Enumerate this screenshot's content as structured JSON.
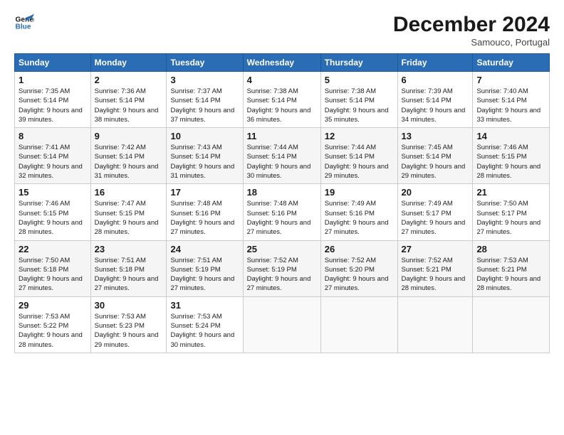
{
  "logo": {
    "line1": "General",
    "line2": "Blue"
  },
  "header": {
    "title": "December 2024",
    "subtitle": "Samouco, Portugal"
  },
  "days_of_week": [
    "Sunday",
    "Monday",
    "Tuesday",
    "Wednesday",
    "Thursday",
    "Friday",
    "Saturday"
  ],
  "weeks": [
    [
      {
        "day": "1",
        "sunrise": "Sunrise: 7:35 AM",
        "sunset": "Sunset: 5:14 PM",
        "daylight": "Daylight: 9 hours and 39 minutes."
      },
      {
        "day": "2",
        "sunrise": "Sunrise: 7:36 AM",
        "sunset": "Sunset: 5:14 PM",
        "daylight": "Daylight: 9 hours and 38 minutes."
      },
      {
        "day": "3",
        "sunrise": "Sunrise: 7:37 AM",
        "sunset": "Sunset: 5:14 PM",
        "daylight": "Daylight: 9 hours and 37 minutes."
      },
      {
        "day": "4",
        "sunrise": "Sunrise: 7:38 AM",
        "sunset": "Sunset: 5:14 PM",
        "daylight": "Daylight: 9 hours and 36 minutes."
      },
      {
        "day": "5",
        "sunrise": "Sunrise: 7:38 AM",
        "sunset": "Sunset: 5:14 PM",
        "daylight": "Daylight: 9 hours and 35 minutes."
      },
      {
        "day": "6",
        "sunrise": "Sunrise: 7:39 AM",
        "sunset": "Sunset: 5:14 PM",
        "daylight": "Daylight: 9 hours and 34 minutes."
      },
      {
        "day": "7",
        "sunrise": "Sunrise: 7:40 AM",
        "sunset": "Sunset: 5:14 PM",
        "daylight": "Daylight: 9 hours and 33 minutes."
      }
    ],
    [
      {
        "day": "8",
        "sunrise": "Sunrise: 7:41 AM",
        "sunset": "Sunset: 5:14 PM",
        "daylight": "Daylight: 9 hours and 32 minutes."
      },
      {
        "day": "9",
        "sunrise": "Sunrise: 7:42 AM",
        "sunset": "Sunset: 5:14 PM",
        "daylight": "Daylight: 9 hours and 31 minutes."
      },
      {
        "day": "10",
        "sunrise": "Sunrise: 7:43 AM",
        "sunset": "Sunset: 5:14 PM",
        "daylight": "Daylight: 9 hours and 31 minutes."
      },
      {
        "day": "11",
        "sunrise": "Sunrise: 7:44 AM",
        "sunset": "Sunset: 5:14 PM",
        "daylight": "Daylight: 9 hours and 30 minutes."
      },
      {
        "day": "12",
        "sunrise": "Sunrise: 7:44 AM",
        "sunset": "Sunset: 5:14 PM",
        "daylight": "Daylight: 9 hours and 29 minutes."
      },
      {
        "day": "13",
        "sunrise": "Sunrise: 7:45 AM",
        "sunset": "Sunset: 5:14 PM",
        "daylight": "Daylight: 9 hours and 29 minutes."
      },
      {
        "day": "14",
        "sunrise": "Sunrise: 7:46 AM",
        "sunset": "Sunset: 5:15 PM",
        "daylight": "Daylight: 9 hours and 28 minutes."
      }
    ],
    [
      {
        "day": "15",
        "sunrise": "Sunrise: 7:46 AM",
        "sunset": "Sunset: 5:15 PM",
        "daylight": "Daylight: 9 hours and 28 minutes."
      },
      {
        "day": "16",
        "sunrise": "Sunrise: 7:47 AM",
        "sunset": "Sunset: 5:15 PM",
        "daylight": "Daylight: 9 hours and 28 minutes."
      },
      {
        "day": "17",
        "sunrise": "Sunrise: 7:48 AM",
        "sunset": "Sunset: 5:16 PM",
        "daylight": "Daylight: 9 hours and 27 minutes."
      },
      {
        "day": "18",
        "sunrise": "Sunrise: 7:48 AM",
        "sunset": "Sunset: 5:16 PM",
        "daylight": "Daylight: 9 hours and 27 minutes."
      },
      {
        "day": "19",
        "sunrise": "Sunrise: 7:49 AM",
        "sunset": "Sunset: 5:16 PM",
        "daylight": "Daylight: 9 hours and 27 minutes."
      },
      {
        "day": "20",
        "sunrise": "Sunrise: 7:49 AM",
        "sunset": "Sunset: 5:17 PM",
        "daylight": "Daylight: 9 hours and 27 minutes."
      },
      {
        "day": "21",
        "sunrise": "Sunrise: 7:50 AM",
        "sunset": "Sunset: 5:17 PM",
        "daylight": "Daylight: 9 hours and 27 minutes."
      }
    ],
    [
      {
        "day": "22",
        "sunrise": "Sunrise: 7:50 AM",
        "sunset": "Sunset: 5:18 PM",
        "daylight": "Daylight: 9 hours and 27 minutes."
      },
      {
        "day": "23",
        "sunrise": "Sunrise: 7:51 AM",
        "sunset": "Sunset: 5:18 PM",
        "daylight": "Daylight: 9 hours and 27 minutes."
      },
      {
        "day": "24",
        "sunrise": "Sunrise: 7:51 AM",
        "sunset": "Sunset: 5:19 PM",
        "daylight": "Daylight: 9 hours and 27 minutes."
      },
      {
        "day": "25",
        "sunrise": "Sunrise: 7:52 AM",
        "sunset": "Sunset: 5:19 PM",
        "daylight": "Daylight: 9 hours and 27 minutes."
      },
      {
        "day": "26",
        "sunrise": "Sunrise: 7:52 AM",
        "sunset": "Sunset: 5:20 PM",
        "daylight": "Daylight: 9 hours and 27 minutes."
      },
      {
        "day": "27",
        "sunrise": "Sunrise: 7:52 AM",
        "sunset": "Sunset: 5:21 PM",
        "daylight": "Daylight: 9 hours and 28 minutes."
      },
      {
        "day": "28",
        "sunrise": "Sunrise: 7:53 AM",
        "sunset": "Sunset: 5:21 PM",
        "daylight": "Daylight: 9 hours and 28 minutes."
      }
    ],
    [
      {
        "day": "29",
        "sunrise": "Sunrise: 7:53 AM",
        "sunset": "Sunset: 5:22 PM",
        "daylight": "Daylight: 9 hours and 28 minutes."
      },
      {
        "day": "30",
        "sunrise": "Sunrise: 7:53 AM",
        "sunset": "Sunset: 5:23 PM",
        "daylight": "Daylight: 9 hours and 29 minutes."
      },
      {
        "day": "31",
        "sunrise": "Sunrise: 7:53 AM",
        "sunset": "Sunset: 5:24 PM",
        "daylight": "Daylight: 9 hours and 30 minutes."
      },
      null,
      null,
      null,
      null
    ]
  ]
}
